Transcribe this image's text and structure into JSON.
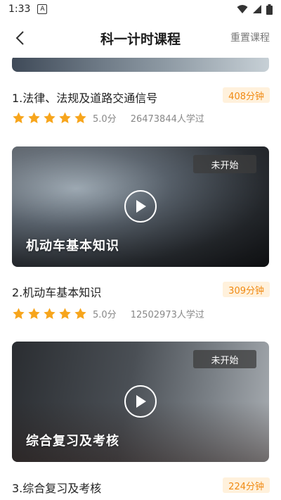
{
  "status": {
    "time": "1:33",
    "notification_icon": "a-box-icon",
    "icons": [
      "wifi-icon",
      "signal-icon",
      "battery-icon"
    ]
  },
  "header": {
    "back_icon": "chevron-left-icon",
    "title": "科一计时课程",
    "reset_label": "重置课程"
  },
  "colors": {
    "accent": "#f08a13",
    "accent_bg": "#fff1dc",
    "star": "#f7a51c"
  },
  "courses": [
    {
      "title": "1.法律、法规及道路交通信号",
      "minutes": "408分钟",
      "rating_label": "5.0分",
      "rating": 5,
      "learners": "26473844人学过"
    },
    {
      "badge": "未开始",
      "caption": "机动车基本知识",
      "title": "2.机动车基本知识",
      "minutes": "309分钟",
      "rating_label": "5.0分",
      "rating": 5,
      "learners": "12502973人学过"
    },
    {
      "badge": "未开始",
      "caption": "综合复习及考核",
      "title": "3.综合复习及考核",
      "minutes": "224分钟"
    }
  ]
}
